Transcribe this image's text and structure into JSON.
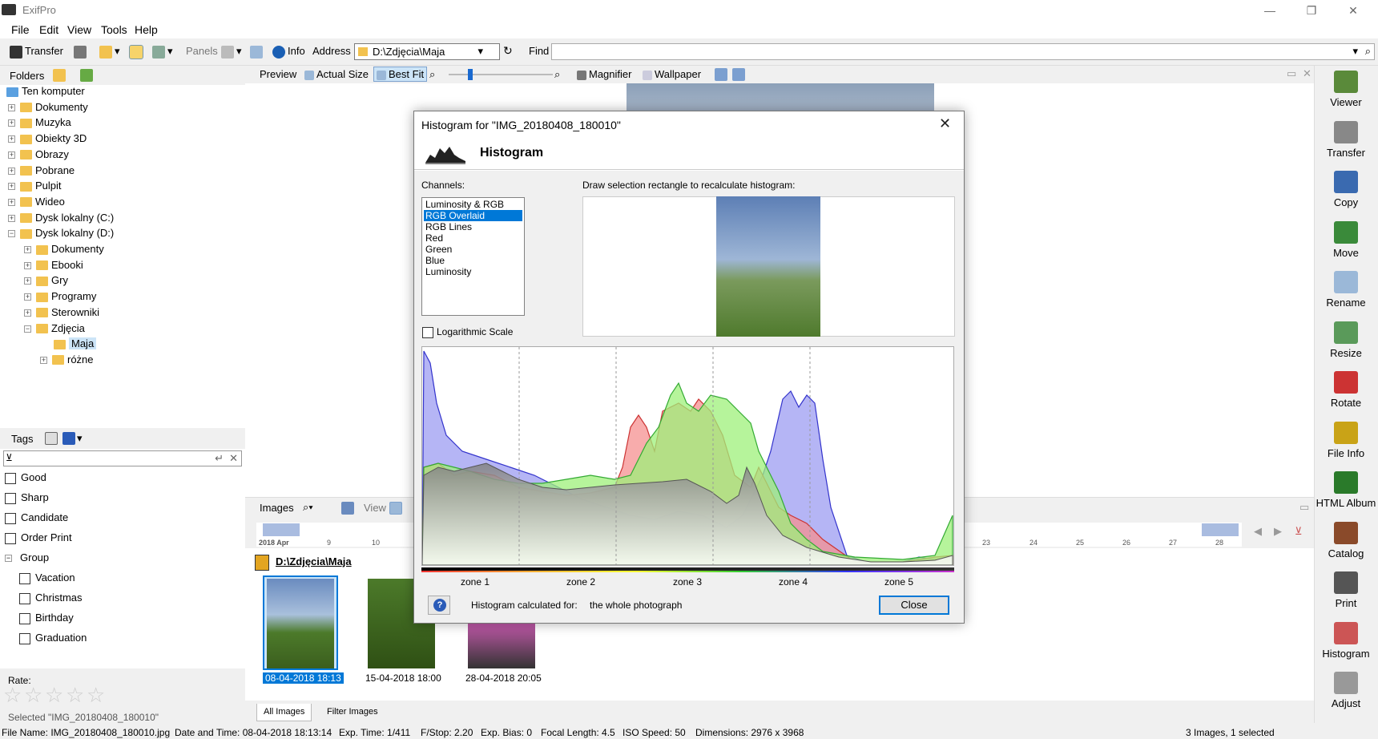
{
  "window": {
    "title": "ExifPro",
    "minimize": "—",
    "maximize": "❐",
    "close": "✕"
  },
  "menu": [
    "File",
    "Edit",
    "View",
    "Tools",
    "Help"
  ],
  "toolbar": {
    "transfer": "Transfer",
    "panels": "Panels",
    "info": "Info",
    "address_label": "Address",
    "address_value": "D:\\Zdjęcia\\Maja",
    "find_label": "Find"
  },
  "folders": {
    "header": "Folders",
    "items": [
      {
        "label": "Ten komputer",
        "level": 0
      },
      {
        "label": "Dokumenty",
        "level": 1
      },
      {
        "label": "Muzyka",
        "level": 1
      },
      {
        "label": "Obiekty 3D",
        "level": 1
      },
      {
        "label": "Obrazy",
        "level": 1
      },
      {
        "label": "Pobrane",
        "level": 1
      },
      {
        "label": "Pulpit",
        "level": 1
      },
      {
        "label": "Wideo",
        "level": 1
      },
      {
        "label": "Dysk lokalny (C:)",
        "level": 1
      },
      {
        "label": "Dysk lokalny (D:)",
        "level": 1
      },
      {
        "label": "Dokumenty",
        "level": 2
      },
      {
        "label": "Ebooki",
        "level": 2
      },
      {
        "label": "Gry",
        "level": 2
      },
      {
        "label": "Programy",
        "level": 2
      },
      {
        "label": "Sterowniki",
        "level": 2
      },
      {
        "label": "Zdjęcia",
        "level": 2
      },
      {
        "label": "Maja",
        "level": 3
      },
      {
        "label": "różne",
        "level": 3
      }
    ]
  },
  "tags": {
    "header": "Tags",
    "items": [
      "Good",
      "Sharp",
      "Candidate",
      "Order Print"
    ],
    "group": "Group",
    "group_items": [
      "Vacation",
      "Christmas",
      "Birthday",
      "Graduation"
    ]
  },
  "rate": {
    "label": "Rate:",
    "selected": "Selected \"IMG_20180408_180010\""
  },
  "preview_toolbar": {
    "preview": "Preview",
    "actual_size": "Actual Size",
    "best_fit": "Best Fit",
    "magnifier": "Magnifier",
    "wallpaper": "Wallpaper"
  },
  "images_toolbar": {
    "images": "Images",
    "view": "View"
  },
  "timeline": {
    "month": "2018 Apr",
    "days": [
      "9",
      "10",
      "23",
      "24",
      "25",
      "26",
      "27",
      "28"
    ]
  },
  "images": {
    "folder_path": "D:\\Zdjęcia\\Maja",
    "thumbs": [
      "08-04-2018  18:13",
      "15-04-2018  18:00",
      "28-04-2018  20:05"
    ]
  },
  "bottom_tabs": [
    "All Images",
    "Filter Images"
  ],
  "status": {
    "file_name": "File Name: IMG_20180408_180010.jpg",
    "date_time": "Date and Time: 08-04-2018  18:13:14",
    "exp_time": "Exp. Time: 1/411",
    "fstop": "F/Stop: 2.20",
    "exp_bias": "Exp. Bias: 0",
    "focal": "Focal Length: 4.5",
    "iso": "ISO Speed: 50",
    "dimensions": "Dimensions: 2976 x 3968",
    "count": "3 Images, 1 selected"
  },
  "right_bar": [
    "Viewer",
    "Transfer",
    "Copy",
    "Move",
    "Rename",
    "Resize",
    "Rotate",
    "File Info",
    "HTML Album",
    "Catalog",
    "Print",
    "Histogram",
    "Adjust"
  ],
  "dialog": {
    "title": "Histogram for \"IMG_20180408_180010\"",
    "header": "Histogram",
    "channels_label": "Channels:",
    "channels": [
      "Luminosity & RGB",
      "RGB Overlaid",
      "RGB Lines",
      "Red",
      "Green",
      "Blue",
      "Luminosity"
    ],
    "selected_channel": "RGB Overlaid",
    "selection_hint": "Draw selection rectangle to recalculate histogram:",
    "log_scale": "Logarithmic Scale",
    "zones": [
      "zone 1",
      "zone 2",
      "zone 3",
      "zone 4",
      "zone 5"
    ],
    "calc_label": "Histogram calculated for:",
    "calc_value": "the whole photograph",
    "close_button": "Close"
  },
  "colors": {
    "selection": "#0078d7",
    "hist_red": "#f08080",
    "hist_green": "#90e870",
    "hist_blue": "#8c8cf0",
    "hist_luma": "#a0a0a0"
  }
}
